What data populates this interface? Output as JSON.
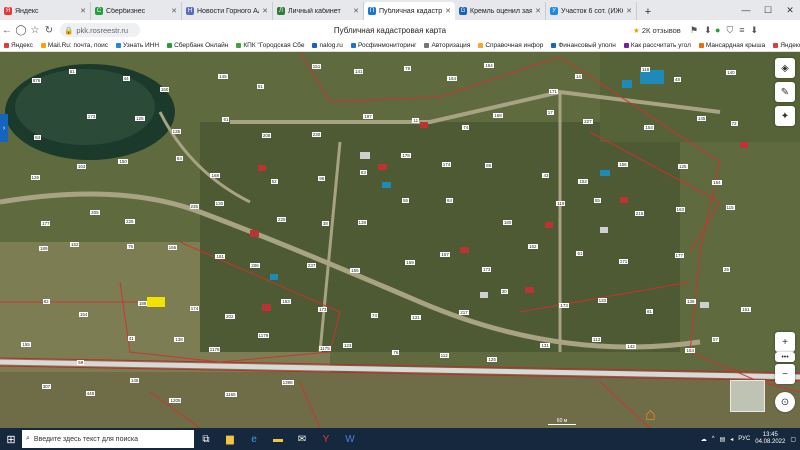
{
  "tabs": [
    {
      "label": "Яндекс",
      "color": "#e53935",
      "glyph": "Я"
    },
    {
      "label": "Сбербизнес",
      "color": "#21a038",
      "glyph": "С"
    },
    {
      "label": "Новости Горного Ал",
      "color": "#5c6bc0",
      "glyph": "Н"
    },
    {
      "label": "Личный кабинет",
      "color": "#2e7d32",
      "glyph": "Л"
    },
    {
      "label": "Публичная кадастр",
      "color": "#1976d2",
      "glyph": "П",
      "active": true
    },
    {
      "label": "Кремль оценил заяв",
      "color": "#1565c0",
      "glyph": "G"
    },
    {
      "label": "Участок 6 сот. (ИЖС",
      "color": "#1e88e5",
      "glyph": "У"
    }
  ],
  "address": {
    "url": "pkk.rosreestr.ru",
    "page_title": "Публичная кадастровая карта",
    "reviews": "2К отзывов"
  },
  "bookmarks": [
    {
      "label": "Яндекс",
      "color": "#e53935"
    },
    {
      "label": "Mail.Ru: почта, поис",
      "color": "#ffa000"
    },
    {
      "label": "Узнать ИНН",
      "color": "#1e88e5"
    },
    {
      "label": "Сбербанк Онлайн",
      "color": "#21a038"
    },
    {
      "label": "КПК \"Городская Сбе",
      "color": "#43a047"
    },
    {
      "label": "nalog.ru",
      "color": "#1565c0"
    },
    {
      "label": "Росфинмониторинг",
      "color": "#1976d2"
    },
    {
      "label": "Авторизация",
      "color": "#757575"
    },
    {
      "label": "Справочная инфор",
      "color": "#f9a825"
    },
    {
      "label": "Финансовый уполн",
      "color": "#1565c0"
    },
    {
      "label": "Как рассчитать угол",
      "color": "#7b1fa2"
    },
    {
      "label": "Мансардная крыша",
      "color": "#ef6c00"
    },
    {
      "label": "Яндекс",
      "color": "#e53935"
    }
  ],
  "parcels": [
    "676",
    "51",
    "44",
    "160",
    "145",
    "91",
    "151",
    "141",
    "78",
    "164",
    "164",
    "171",
    "14",
    "118",
    "48",
    "140",
    "84",
    "173",
    "125",
    "135",
    "61",
    "208",
    "230",
    "197",
    "11",
    "74",
    "168",
    "17",
    "227",
    "154",
    "145",
    "72",
    "126",
    "163",
    "150",
    "84",
    "168",
    "52",
    "96",
    "63",
    "178",
    "174",
    "86",
    "43",
    "152",
    "156",
    "125",
    "164",
    "177",
    "205",
    "226",
    "235",
    "130",
    "225",
    "38",
    "138",
    "56",
    "84",
    "180",
    "119",
    "55",
    "215",
    "163",
    "115",
    "189",
    "152",
    "76",
    "166",
    "181",
    "206",
    "237",
    "155",
    "159",
    "157",
    "173",
    "162",
    "61",
    "171",
    "177",
    "26",
    "82",
    "154",
    "189",
    "174",
    "202",
    "153",
    "173",
    "74",
    "131",
    "217",
    "30",
    "173",
    "133",
    "81",
    "136",
    "161",
    "155",
    "59",
    "41",
    "138",
    "1178",
    "1179",
    "1175",
    "123",
    "76",
    "112",
    "125",
    "131",
    "113",
    "142",
    "154",
    "57",
    "307",
    "448",
    "145",
    "1205",
    "1165",
    "1398"
  ],
  "map_controls": [
    "layers-icon",
    "ruler-icon",
    "compass-icon",
    "zoom-in-icon",
    "zoom-out-icon",
    "more-icon",
    "fullscreen-icon"
  ],
  "scale_label": "60 м",
  "taskbar": {
    "search_placeholder": "Введите здесь текст для поиска",
    "time": "13:45",
    "date": "04.08.2022",
    "lang": "РУС"
  }
}
